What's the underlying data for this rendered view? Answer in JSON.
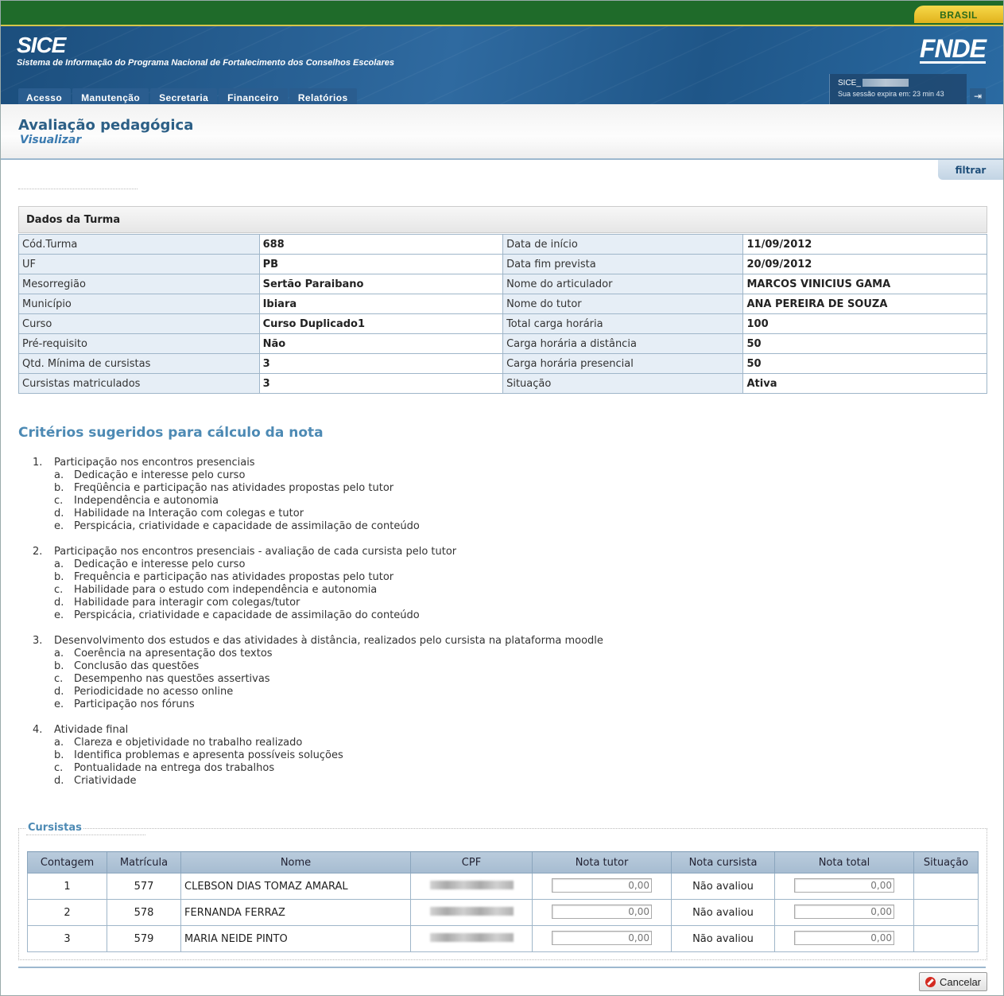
{
  "gov": {
    "brand": "BRASIL"
  },
  "header": {
    "logo": "SICE",
    "subtitle": "Sistema de Informação do Programa Nacional de Fortalecimento dos Conselhos Escolares",
    "org": "FNDE",
    "menu": [
      "Acesso",
      "Manutenção",
      "Secretaria",
      "Financeiro",
      "Relatórios"
    ],
    "session_user": "SICE_",
    "session_expire": "Sua sessão expira em: 23 min 43"
  },
  "page": {
    "title": "Avaliação pedagógica",
    "subtitle": "Visualizar",
    "filter_tab": "filtrar"
  },
  "dados": {
    "heading": "Dados da Turma",
    "rows": [
      {
        "l1": "Cód.Turma",
        "v1": "688",
        "l2": "Data de início",
        "v2": "11/09/2012"
      },
      {
        "l1": "UF",
        "v1": "PB",
        "l2": "Data fim prevista",
        "v2": "20/09/2012"
      },
      {
        "l1": "Mesorregião",
        "v1": "Sertão Paraibano",
        "l2": "Nome do articulador",
        "v2": "MARCOS VINICIUS GAMA"
      },
      {
        "l1": "Município",
        "v1": "Ibiara",
        "l2": "Nome do tutor",
        "v2": "ANA PEREIRA DE SOUZA"
      },
      {
        "l1": "Curso",
        "v1": "Curso Duplicado1",
        "l2": "Total carga horária",
        "v2": "100"
      },
      {
        "l1": "Pré-requisito",
        "v1": "Não",
        "l2": "Carga horária a distância",
        "v2": "50"
      },
      {
        "l1": "Qtd. Mínima de cursistas",
        "v1": "3",
        "l2": "Carga horária presencial",
        "v2": "50"
      },
      {
        "l1": "Cursistas matriculados",
        "v1": "3",
        "l2": "Situação",
        "v2": "Ativa"
      }
    ]
  },
  "criteria": {
    "title": "Critérios sugeridos para cálculo da nota",
    "groups": [
      {
        "num": "1.",
        "label": "Participação nos encontros presenciais",
        "items": [
          {
            "l": "a.",
            "t": "Dedicação e interesse pelo curso"
          },
          {
            "l": "b.",
            "t": "Freqüência e participação nas atividades propostas pelo tutor"
          },
          {
            "l": "c.",
            "t": "Independência e autonomia"
          },
          {
            "l": "d.",
            "t": "Habilidade na Interação com colegas e tutor"
          },
          {
            "l": "e.",
            "t": "Perspicácia, criatividade e capacidade de assimilação de conteúdo"
          }
        ]
      },
      {
        "num": "2.",
        "label": "Participação nos encontros presenciais - avaliação de cada cursista pelo tutor",
        "items": [
          {
            "l": "a.",
            "t": "Dedicação e interesse pelo curso"
          },
          {
            "l": "b.",
            "t": "Frequência e participação nas atividades propostas pelo tutor"
          },
          {
            "l": "c.",
            "t": "Habilidade para o estudo com independência e autonomia"
          },
          {
            "l": "d.",
            "t": "Habilidade para interagir com colegas/tutor"
          },
          {
            "l": "e.",
            "t": "Perspicácia, criatividade e capacidade de assimilação do conteúdo"
          }
        ]
      },
      {
        "num": "3.",
        "label": "Desenvolvimento dos estudos e das atividades à distância, realizados pelo cursista na plataforma moodle",
        "items": [
          {
            "l": "a.",
            "t": "Coerência na apresentação dos textos"
          },
          {
            "l": "b.",
            "t": "Conclusão das questões"
          },
          {
            "l": "c.",
            "t": "Desempenho nas questões assertivas"
          },
          {
            "l": "d.",
            "t": "Periodicidade no acesso online"
          },
          {
            "l": "e.",
            "t": "Participação nos fóruns"
          }
        ]
      },
      {
        "num": "4.",
        "label": "Atividade final",
        "items": [
          {
            "l": "a.",
            "t": "Clareza e objetividade no trabalho realizado"
          },
          {
            "l": "b.",
            "t": "Identifica problemas e apresenta possíveis soluções"
          },
          {
            "l": "c.",
            "t": "Pontualidade na entrega dos trabalhos"
          },
          {
            "l": "d.",
            "t": "Criatividade"
          }
        ]
      }
    ]
  },
  "cursistas": {
    "legend": "Cursistas",
    "headers": [
      "Contagem",
      "Matrícula",
      "Nome",
      "CPF",
      "Nota tutor",
      "Nota cursista",
      "Nota total",
      "Situação"
    ],
    "rows": [
      {
        "contagem": "1",
        "matricula": "577",
        "nome": "CLEBSON DIAS TOMAZ AMARAL",
        "nota_tutor": "0,00",
        "nota_cursista": "Não avaliou",
        "nota_total": "0,00",
        "situacao": ""
      },
      {
        "contagem": "2",
        "matricula": "578",
        "nome": "FERNANDA FERRAZ",
        "nota_tutor": "0,00",
        "nota_cursista": "Não avaliou",
        "nota_total": "0,00",
        "situacao": ""
      },
      {
        "contagem": "3",
        "matricula": "579",
        "nome": "MARIA NEIDE PINTO",
        "nota_tutor": "0,00",
        "nota_cursista": "Não avaliou",
        "nota_total": "0,00",
        "situacao": ""
      }
    ]
  },
  "actions": {
    "cancel_label": "Cancelar"
  }
}
